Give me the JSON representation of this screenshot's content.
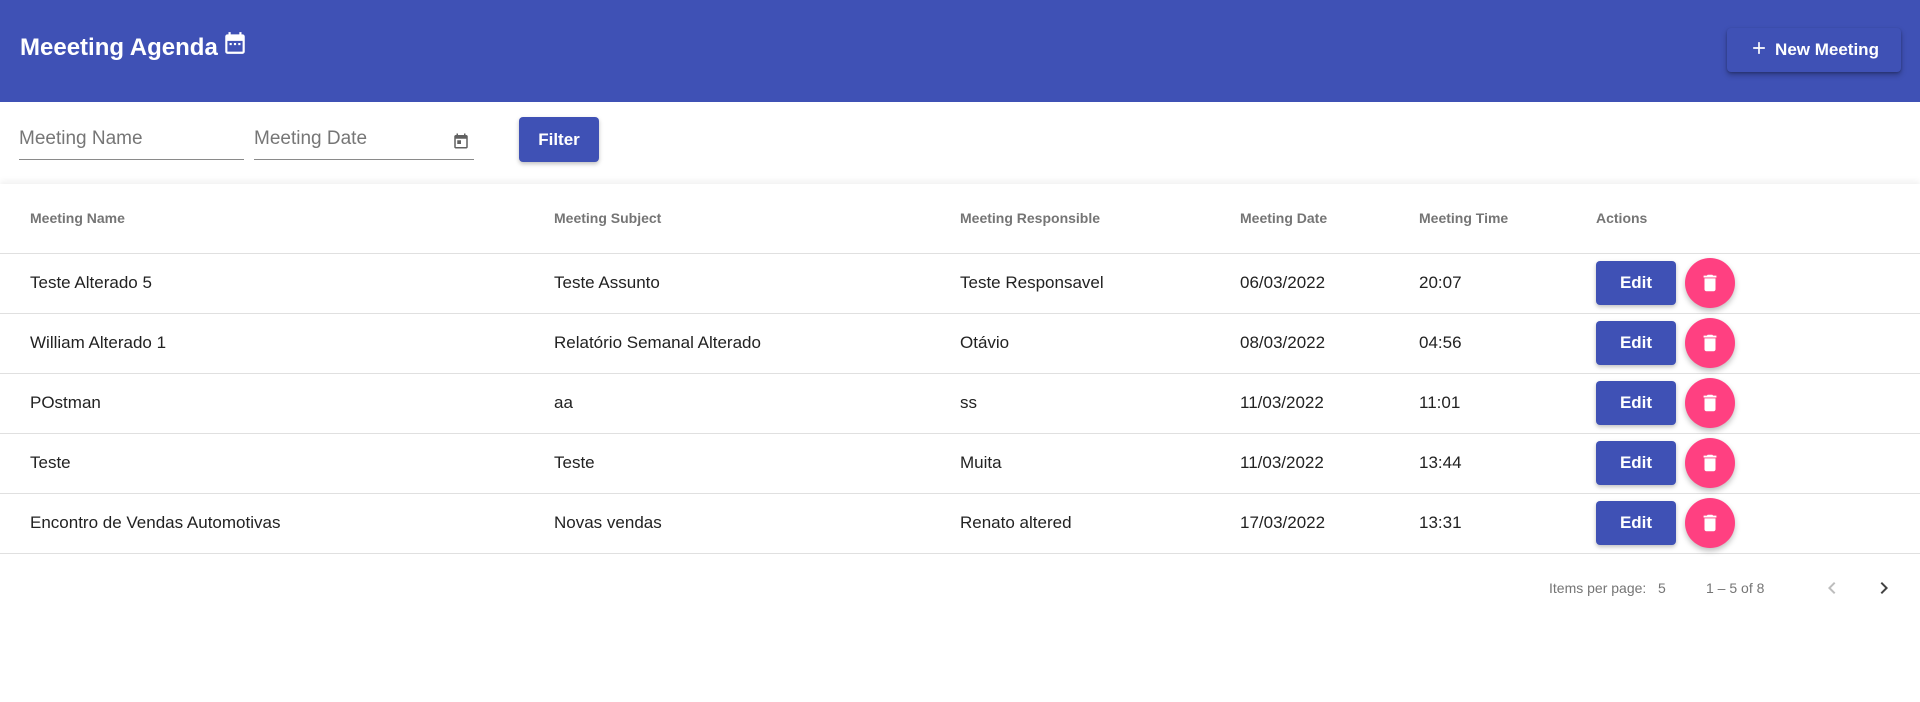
{
  "header": {
    "title": "Meeeting Agenda",
    "title_icon": "calendar-icon",
    "new_meeting_label": "New Meeting",
    "new_meeting_icon": "plus-icon",
    "background_color": "#3f51b5"
  },
  "filters": {
    "name_placeholder": "Meeting Name",
    "name_value": "",
    "date_placeholder": "Meeting Date",
    "date_value": "",
    "date_icon": "calendar-icon",
    "filter_label": "Filter"
  },
  "table": {
    "columns": [
      "Meeting Name",
      "Meeting Subject",
      "Meeting Responsible",
      "Meeting Date",
      "Meeting Time",
      "Actions"
    ],
    "rows": [
      {
        "name": "Teste Alterado 5",
        "subject": "Teste Assunto",
        "responsible": "Teste Responsavel",
        "date": "06/03/2022",
        "time": "20:07"
      },
      {
        "name": "William Alterado 1",
        "subject": "Relatório Semanal Alterado",
        "responsible": "Otávio",
        "date": "08/03/2022",
        "time": "04:56"
      },
      {
        "name": "POstman",
        "subject": "aa",
        "responsible": "ss",
        "date": "11/03/2022",
        "time": "11:01"
      },
      {
        "name": "Teste",
        "subject": "Teste",
        "responsible": "Muita",
        "date": "11/03/2022",
        "time": "13:44"
      },
      {
        "name": "Encontro de Vendas Automotivas",
        "subject": "Novas vendas",
        "responsible": "Renato altered",
        "date": "17/03/2022",
        "time": "13:31"
      }
    ],
    "edit_label": "Edit",
    "delete_icon": "trash-icon",
    "accent_color": "#ff4081"
  },
  "paginator": {
    "items_per_page_label": "Items per page:",
    "page_size": "5",
    "range_label": "1 – 5 of 8"
  }
}
